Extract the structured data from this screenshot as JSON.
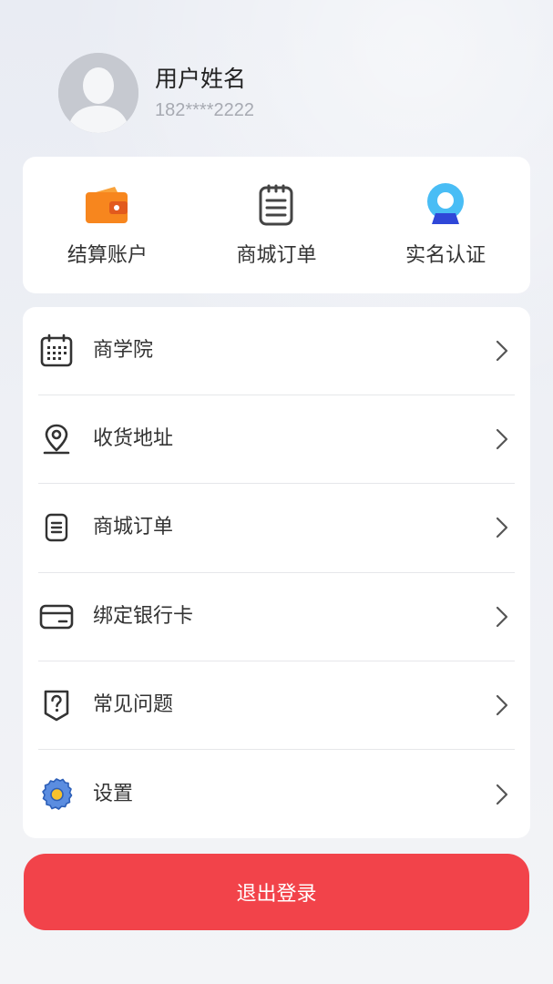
{
  "profile": {
    "name": "用户姓名",
    "phone": "182****2222"
  },
  "quick_actions": [
    {
      "label": "结算账户",
      "icon": "wallet-icon",
      "color": "#f7861e"
    },
    {
      "label": "商城订单",
      "icon": "order-list-icon",
      "color": "#333333"
    },
    {
      "label": "实名认证",
      "icon": "verified-user-icon",
      "color": "#3fb6f2"
    }
  ],
  "menu": [
    {
      "label": "商学院",
      "icon": "calendar-icon"
    },
    {
      "label": "收货地址",
      "icon": "location-pin-icon"
    },
    {
      "label": "商城订单",
      "icon": "order-list-icon"
    },
    {
      "label": "绑定银行卡",
      "icon": "bank-card-icon"
    },
    {
      "label": "常见问题",
      "icon": "question-shield-icon"
    },
    {
      "label": "设置",
      "icon": "gear-icon"
    }
  ],
  "logout_label": "退出登录",
  "colors": {
    "accent": "#f2434a",
    "text": "#333333",
    "muted": "#a7aab2"
  }
}
